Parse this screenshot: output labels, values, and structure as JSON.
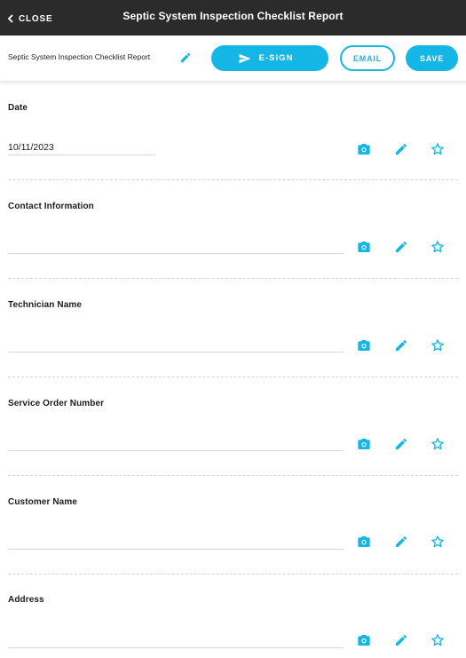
{
  "header": {
    "close_label": "CLOSE",
    "title": "Septic System Inspection Checklist Report"
  },
  "toolbar": {
    "document_name": "Septic System Inspection Checklist Report",
    "esign_label": "E-SIGN",
    "email_label": "EMAIL",
    "save_label": "SAVE"
  },
  "colors": {
    "accent": "#14b6e6",
    "header_bg": "#2b2b2b"
  },
  "fields": [
    {
      "label": "Date",
      "value": "10/11/2023",
      "icons": [
        "camera-icon",
        "pencil-icon",
        "star-icon"
      ]
    },
    {
      "label": "Contact Information",
      "value": "",
      "icons": [
        "camera-icon",
        "pencil-icon",
        "star-icon"
      ]
    },
    {
      "label": "Technician Name",
      "value": "",
      "icons": [
        "camera-icon",
        "pencil-icon",
        "star-icon"
      ]
    },
    {
      "label": "Service Order Number",
      "value": "",
      "icons": [
        "camera-icon",
        "pencil-icon",
        "star-icon"
      ]
    },
    {
      "label": "Customer Name",
      "value": "",
      "icons": [
        "camera-icon",
        "pencil-icon",
        "star-icon"
      ]
    },
    {
      "label": "Address",
      "value": "",
      "icons": [
        "camera-icon",
        "pencil-icon",
        "star-icon"
      ]
    }
  ]
}
